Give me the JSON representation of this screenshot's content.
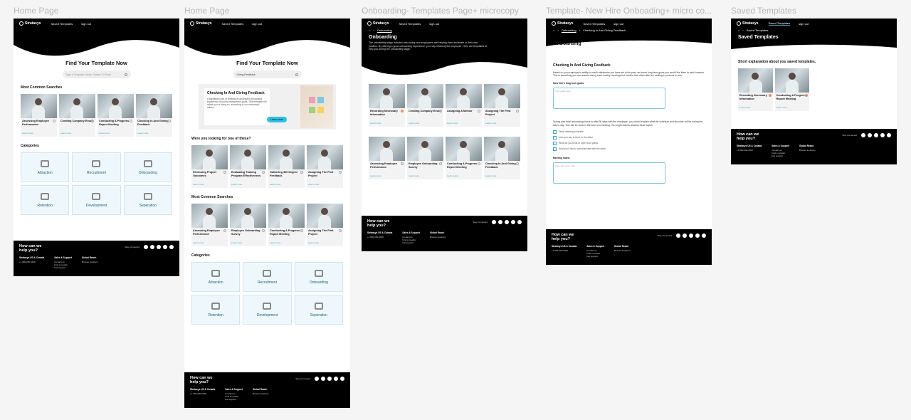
{
  "frames": [
    {
      "label": "Home Page"
    },
    {
      "label": "Home Page"
    },
    {
      "label": "Onboarding- Templates Page+ microcopy"
    },
    {
      "label": "Template- New Hire Onboading+ micro co..."
    },
    {
      "label": "Saved Templates"
    }
  ],
  "nav": {
    "brand": "Stratasys",
    "saved": "Saved Templates",
    "signout": "sign out"
  },
  "home": {
    "title": "Find Your Template Now",
    "search_placeholder": "Type a Template Name, Subject Or Topic...",
    "search_value": "Giving Feedback",
    "common_heading": "Most Common Searches",
    "suggest_heading": "Were you looking for one of these?",
    "categories_heading": "Categories",
    "common_cards": [
      "Assessing Employee Performance",
      "Creating Company Email",
      "Conducting A Progress Report Meeting",
      "Checking In And Giving Feedback"
    ],
    "common_cards_2": [
      "Assessing Employee Performance",
      "Employee Onboarding Survey",
      "Conducting A Progress Report Meeting",
      "Assigning The First Project"
    ],
    "suggest_cards": [
      "Reviewing Project Outcomes",
      "Evaluating Training Program Effectiveness",
      "Gathering 360 Degree Feedback",
      "Assigning The First Project"
    ],
    "learn_more": "Learn more",
    "categories": [
      "Attraction",
      "Recruitment",
      "Onboarding",
      "Retention",
      "Development",
      "Seperation"
    ]
  },
  "featured": {
    "title": "Checking In And Giving Feedback",
    "text": "A significant part of creating a successful onboarding experience is having transparent goals. This template will assist you in doing so, according to our company's values.",
    "button": "Learn more"
  },
  "onboarding": {
    "crumb": "Onboarding",
    "title": "Onboarding",
    "text": "The onboarding stage includes welcoming new employees and helping them acclimate to their new position. By offering a good onboarding experience, you help retaining the employee. Here are templates to help you during the onboarding stage:",
    "cards": [
      "Recording Necessary Information",
      "Creating Company Email",
      "Assigning A Mentor",
      "Assigning The First Project",
      "Assessing Employee Performance",
      "Employee Onboarding Survey",
      "Conducting A Progress Report Meeting",
      "Checking In And Giving Feedback"
    ]
  },
  "template": {
    "crumb1": "Onboarding",
    "crumb2": "Checking In And Giving Feedback",
    "title": "Onboarding",
    "heading": "Checking In And Giving Feedback",
    "para1": "Based on your employee's ability to reach milestones you have set in the past, set some long-term goals you would like them to work towards. This is something you can assess during each weekly meetings but monitor less often after the settling-in process is over.",
    "q1": "New hire's long term goals:",
    "q1_placeholder": "Type goals here...",
    "para2": "During your final onboarding check in after 90 days with the employee, you should explain what the schedule and structure will be during the day to day. This can be done in the form of a meeting. You might want to discuss those topics:",
    "checks": [
      "Team meeting schedule",
      "How you say is done in the office",
      "What do you think of open door policy",
      "How you'd like to communicate with the team"
    ],
    "q2": "Meeting notes:",
    "q2_placeholder": "Type your notes here..."
  },
  "saved": {
    "crumb": "Saved Templates",
    "title": "Saved Templates",
    "subtitle": "Short explanation about you saved templates.",
    "cards": [
      "Recording Necessary Information",
      "Conducting A Progress Report Meeting"
    ]
  },
  "footer": {
    "title": "How can we help you?",
    "stay": "Stay connected",
    "col1_title": "Stratasys US & Canada",
    "col1_line": "+1 800-000-0000",
    "col2_title": "Sales & Support",
    "col2_lines": [
      "Contact us",
      "Find a reseller",
      "Get support"
    ],
    "col3_title": "Global Reach",
    "col3_line": "Browse locations"
  }
}
